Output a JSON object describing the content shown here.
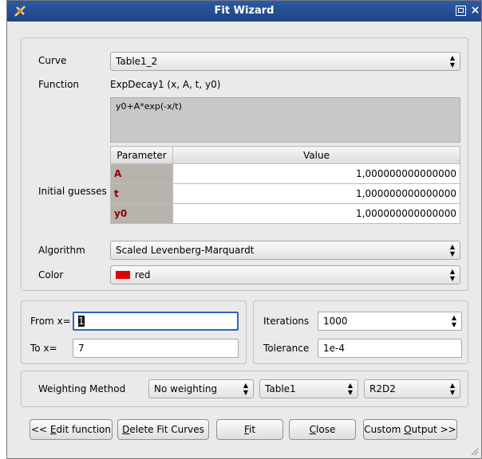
{
  "window": {
    "title": "Fit Wizard",
    "close_glyph": "×"
  },
  "fit": {
    "curve_label": "Curve",
    "curve_value": "Table1_2",
    "function_label": "Function",
    "function_value": "ExpDecay1 (x, A, t, y0)",
    "formula": "y0+A*exp(-x/t)",
    "initial_guesses_label": "Initial guesses",
    "param_header": "Parameter",
    "value_header": "Value",
    "params": [
      {
        "name": "A",
        "value": "1,000000000000000"
      },
      {
        "name": "t",
        "value": "1,000000000000000"
      },
      {
        "name": "y0",
        "value": "1,000000000000000"
      }
    ],
    "algorithm_label": "Algorithm",
    "algorithm_value": "Scaled Levenberg-Marquardt",
    "color_label": "Color",
    "color_value": "red",
    "color_hex": "#e00000"
  },
  "range": {
    "from_label": "From x=",
    "from_value": "1",
    "to_label": "To x=",
    "to_value": "7"
  },
  "options": {
    "iterations_label": "Iterations",
    "iterations_value": "1000",
    "tolerance_label": "Tolerance",
    "tolerance_value": "1e-4"
  },
  "weighting": {
    "label": "Weighting Method",
    "method": "No weighting",
    "table": "Table1",
    "column": "R2D2"
  },
  "buttons": {
    "edit_prefix": "<< ",
    "edit_key": "E",
    "edit_rest": "dit function",
    "delete_key": "D",
    "delete_rest": "elete Fit Curves",
    "fit_key": "F",
    "fit_rest": "it",
    "close_key": "C",
    "close_rest": "lose",
    "custom_prefix": "Custom ",
    "custom_key": "O",
    "custom_rest": "utput >>"
  },
  "colors": {
    "titlebar": "#1f4384",
    "param_name": "#8b0000",
    "focus": "#2f64b8"
  }
}
